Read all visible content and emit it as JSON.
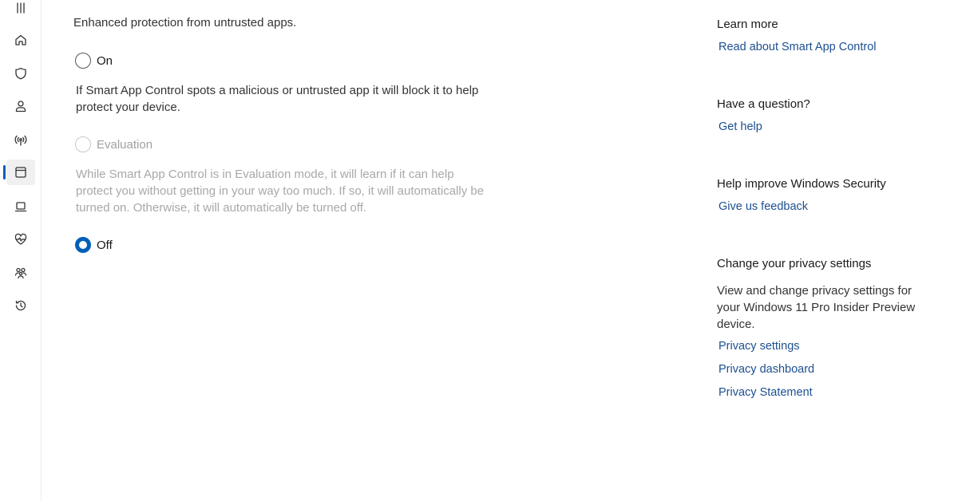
{
  "page": {
    "subtitle": "Enhanced protection from untrusted apps."
  },
  "options": {
    "on": {
      "label": "On",
      "description": "If Smart App Control spots a malicious or untrusted app it will block it to help protect your device."
    },
    "evaluation": {
      "label": "Evaluation",
      "description": "While Smart App Control is in Evaluation mode, it will learn if it can help protect you without getting in your way too much. If so, it will automatically be turned on. Otherwise, it will automatically be turned off."
    },
    "off": {
      "label": "Off"
    },
    "selected": "off"
  },
  "sidebar": {
    "learn_more": {
      "heading": "Learn more",
      "link": "Read about Smart App Control"
    },
    "question": {
      "heading": "Have a question?",
      "link": "Get help"
    },
    "improve": {
      "heading": "Help improve Windows Security",
      "link": "Give us feedback"
    },
    "privacy": {
      "heading": "Change your privacy settings",
      "text": "View and change privacy settings for your Windows 11 Pro Insider Preview device.",
      "links": [
        "Privacy settings",
        "Privacy dashboard",
        "Privacy Statement"
      ]
    }
  },
  "nav": {
    "items": [
      "menu-icon",
      "home-icon",
      "shield-icon",
      "account-icon",
      "wireless-icon",
      "app-browser-icon",
      "device-icon",
      "health-icon",
      "family-icon",
      "history-icon"
    ],
    "active": "app-browser-icon"
  },
  "colors": {
    "accent": "#005fb8",
    "link": "#1d4f91"
  }
}
